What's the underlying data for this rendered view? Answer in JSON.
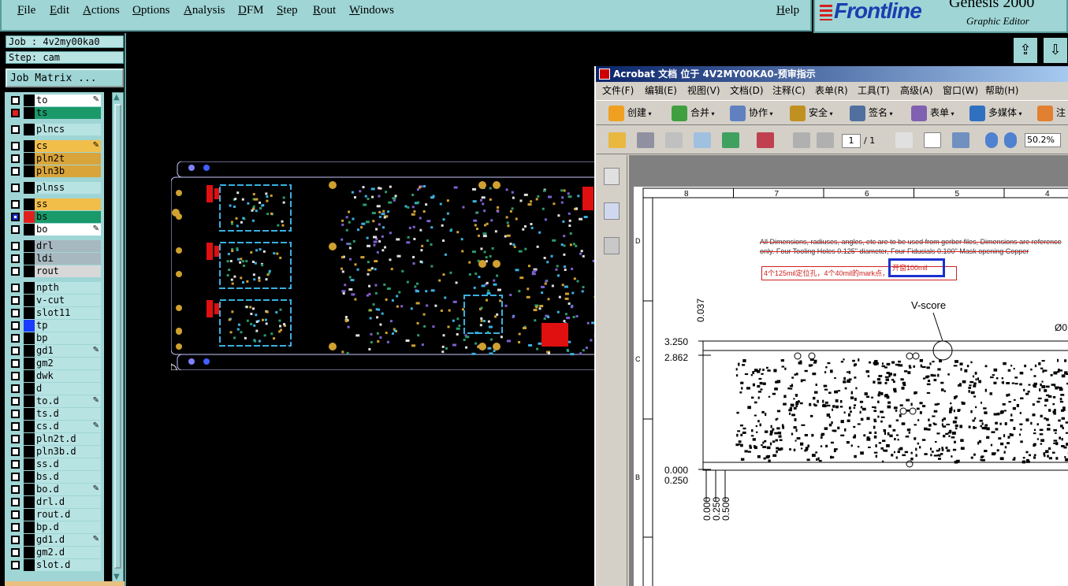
{
  "menubar": {
    "file": "File",
    "edit": "Edit",
    "actions": "Actions",
    "options": "Options",
    "analysis": "Analysis",
    "dfm": "DFM",
    "step": "Step",
    "rout": "Rout",
    "windows": "Windows",
    "help": "Help"
  },
  "brand": {
    "logo": "Frontline",
    "product": "Genesis 2000",
    "subtitle": "Graphic Editor"
  },
  "job": {
    "job_label": "Job : 4v2my00ka0",
    "step_label": "Step: cam",
    "matrix_button": "Job Matrix ..."
  },
  "layers": [
    {
      "name": "to",
      "color": "#ffffff",
      "swatch": "#000000",
      "checked": false,
      "edit": true
    },
    {
      "name": "ts",
      "color": "#1a9a6a",
      "swatch": "#000000",
      "checked": false,
      "marked": true,
      "edit": false
    },
    {
      "name": "plncs",
      "color": "#b8e3e3",
      "swatch": "#000000",
      "checked": false,
      "edit": false
    },
    {
      "name": "cs",
      "color": "#f2be4a",
      "swatch": "#000000",
      "checked": false,
      "edit": true
    },
    {
      "name": "pln2t",
      "color": "#d9a43a",
      "swatch": "#000000",
      "checked": false,
      "edit": false
    },
    {
      "name": "pln3b",
      "color": "#d9a43a",
      "swatch": "#000000",
      "checked": false,
      "edit": false
    },
    {
      "name": "plnss",
      "color": "#b8e3e3",
      "swatch": "#000000",
      "checked": false,
      "edit": false
    },
    {
      "name": "ss",
      "color": "#f2be4a",
      "swatch": "#000000",
      "checked": false,
      "edit": false
    },
    {
      "name": "bs",
      "color": "#1a9a6a",
      "swatch": "#e02020",
      "checked": true,
      "edit": false,
      "pin": true
    },
    {
      "name": "bo",
      "color": "#ffffff",
      "swatch": "#000000",
      "checked": false,
      "edit": true
    },
    {
      "name": "drl",
      "color": "#a8b8c0",
      "swatch": "#000000",
      "checked": false,
      "edit": false
    },
    {
      "name": "ldi",
      "color": "#a8b8c0",
      "swatch": "#000000",
      "checked": false,
      "edit": false
    },
    {
      "name": "rout",
      "color": "#d8d8d8",
      "swatch": "#000000",
      "checked": false,
      "edit": false
    },
    {
      "name": "npth",
      "color": "#b8e3e3",
      "swatch": "#000000",
      "checked": false,
      "edit": false
    },
    {
      "name": "v-cut",
      "color": "#b8e3e3",
      "swatch": "#000000",
      "checked": false,
      "edit": false
    },
    {
      "name": "slot11",
      "color": "#b8e3e3",
      "swatch": "#000000",
      "checked": false,
      "edit": false
    },
    {
      "name": "tp",
      "color": "#b8e3e3",
      "swatch": "#1a3cff",
      "checked": false,
      "edit": false
    },
    {
      "name": "bp",
      "color": "#b8e3e3",
      "swatch": "#000000",
      "checked": false,
      "edit": false
    },
    {
      "name": "gd1",
      "color": "#b8e3e3",
      "swatch": "#000000",
      "checked": false,
      "edit": true
    },
    {
      "name": "gm2",
      "color": "#b8e3e3",
      "swatch": "#000000",
      "checked": false,
      "edit": false
    },
    {
      "name": "dwk",
      "color": "#b8e3e3",
      "swatch": "#000000",
      "checked": false,
      "edit": false
    },
    {
      "name": "d",
      "color": "#b8e3e3",
      "swatch": "#000000",
      "checked": false,
      "edit": false
    },
    {
      "name": "to.d",
      "color": "#b8e3e3",
      "swatch": "#000000",
      "checked": false,
      "edit": true
    },
    {
      "name": "ts.d",
      "color": "#b8e3e3",
      "swatch": "#000000",
      "checked": false,
      "edit": false
    },
    {
      "name": "cs.d",
      "color": "#b8e3e3",
      "swatch": "#000000",
      "checked": false,
      "edit": true
    },
    {
      "name": "pln2t.d",
      "color": "#b8e3e3",
      "swatch": "#000000",
      "checked": false,
      "edit": false
    },
    {
      "name": "pln3b.d",
      "color": "#b8e3e3",
      "swatch": "#000000",
      "checked": false,
      "edit": false
    },
    {
      "name": "ss.d",
      "color": "#b8e3e3",
      "swatch": "#000000",
      "checked": false,
      "edit": false
    },
    {
      "name": "bs.d",
      "color": "#b8e3e3",
      "swatch": "#000000",
      "checked": false,
      "edit": false
    },
    {
      "name": "bo.d",
      "color": "#b8e3e3",
      "swatch": "#000000",
      "checked": false,
      "edit": true
    },
    {
      "name": "drl.d",
      "color": "#b8e3e3",
      "swatch": "#000000",
      "checked": false,
      "edit": false
    },
    {
      "name": "rout.d",
      "color": "#b8e3e3",
      "swatch": "#000000",
      "checked": false,
      "edit": false
    },
    {
      "name": "bp.d",
      "color": "#b8e3e3",
      "swatch": "#000000",
      "checked": false,
      "edit": false
    },
    {
      "name": "gd1.d",
      "color": "#b8e3e3",
      "swatch": "#000000",
      "checked": false,
      "edit": true
    },
    {
      "name": "gm2.d",
      "color": "#b8e3e3",
      "swatch": "#000000",
      "checked": false,
      "edit": false
    },
    {
      "name": "slot.d",
      "color": "#b8e3e3",
      "swatch": "#000000",
      "checked": false,
      "edit": false
    }
  ],
  "acrobat": {
    "title": "Acrobat 文档 位于 4V2MY00KA0-预审指示",
    "menu": [
      "文件(F)",
      "编辑(E)",
      "视图(V)",
      "文档(D)",
      "注释(C)",
      "表单(R)",
      "工具(T)",
      "高级(A)",
      "窗口(W)",
      "帮助(H)"
    ],
    "toolbar": [
      {
        "label": "创建",
        "icon": "create-icon",
        "color": "#f0a020"
      },
      {
        "label": "合并",
        "icon": "combine-icon",
        "color": "#40a040"
      },
      {
        "label": "协作",
        "icon": "collaborate-icon",
        "color": "#6080c0"
      },
      {
        "label": "安全",
        "icon": "lock-icon",
        "color": "#c09020"
      },
      {
        "label": "签名",
        "icon": "pen-icon",
        "color": "#5070a0"
      },
      {
        "label": "表单",
        "icon": "form-icon",
        "color": "#8060b0"
      },
      {
        "label": "多媒体",
        "icon": "multimedia-icon",
        "color": "#3070c0"
      },
      {
        "label": "注",
        "icon": "comment-icon",
        "color": "#e08030"
      }
    ],
    "page_current": "1",
    "page_total": "/ 1",
    "zoom": "50.2%"
  },
  "drawing": {
    "cols": [
      "8",
      "7",
      "6",
      "5",
      "4"
    ],
    "rows": [
      "D",
      "C",
      "B"
    ],
    "note_en": "All Dimensions, radiuses, angles, etc are to be used from gerber files, Dimensions are reference only. Four Tooling Holes 0.125\" diameter, Four Fiducials 0.100\" Mask opening Copper",
    "note_cn_a": "4个125mil定位孔，4个40mil的mark点，",
    "note_cn_b": "开窗100mil",
    "vscore": "V-score",
    "dims": {
      "d3250": "3.250",
      "d2862": "2.862",
      "d0000": "0.000",
      "d0250": "0.250",
      "d0037": "0.037",
      "b0000": "0.000",
      "b0250": "0.250",
      "b0500": "0.500",
      "right_cut": "Ø0"
    }
  }
}
